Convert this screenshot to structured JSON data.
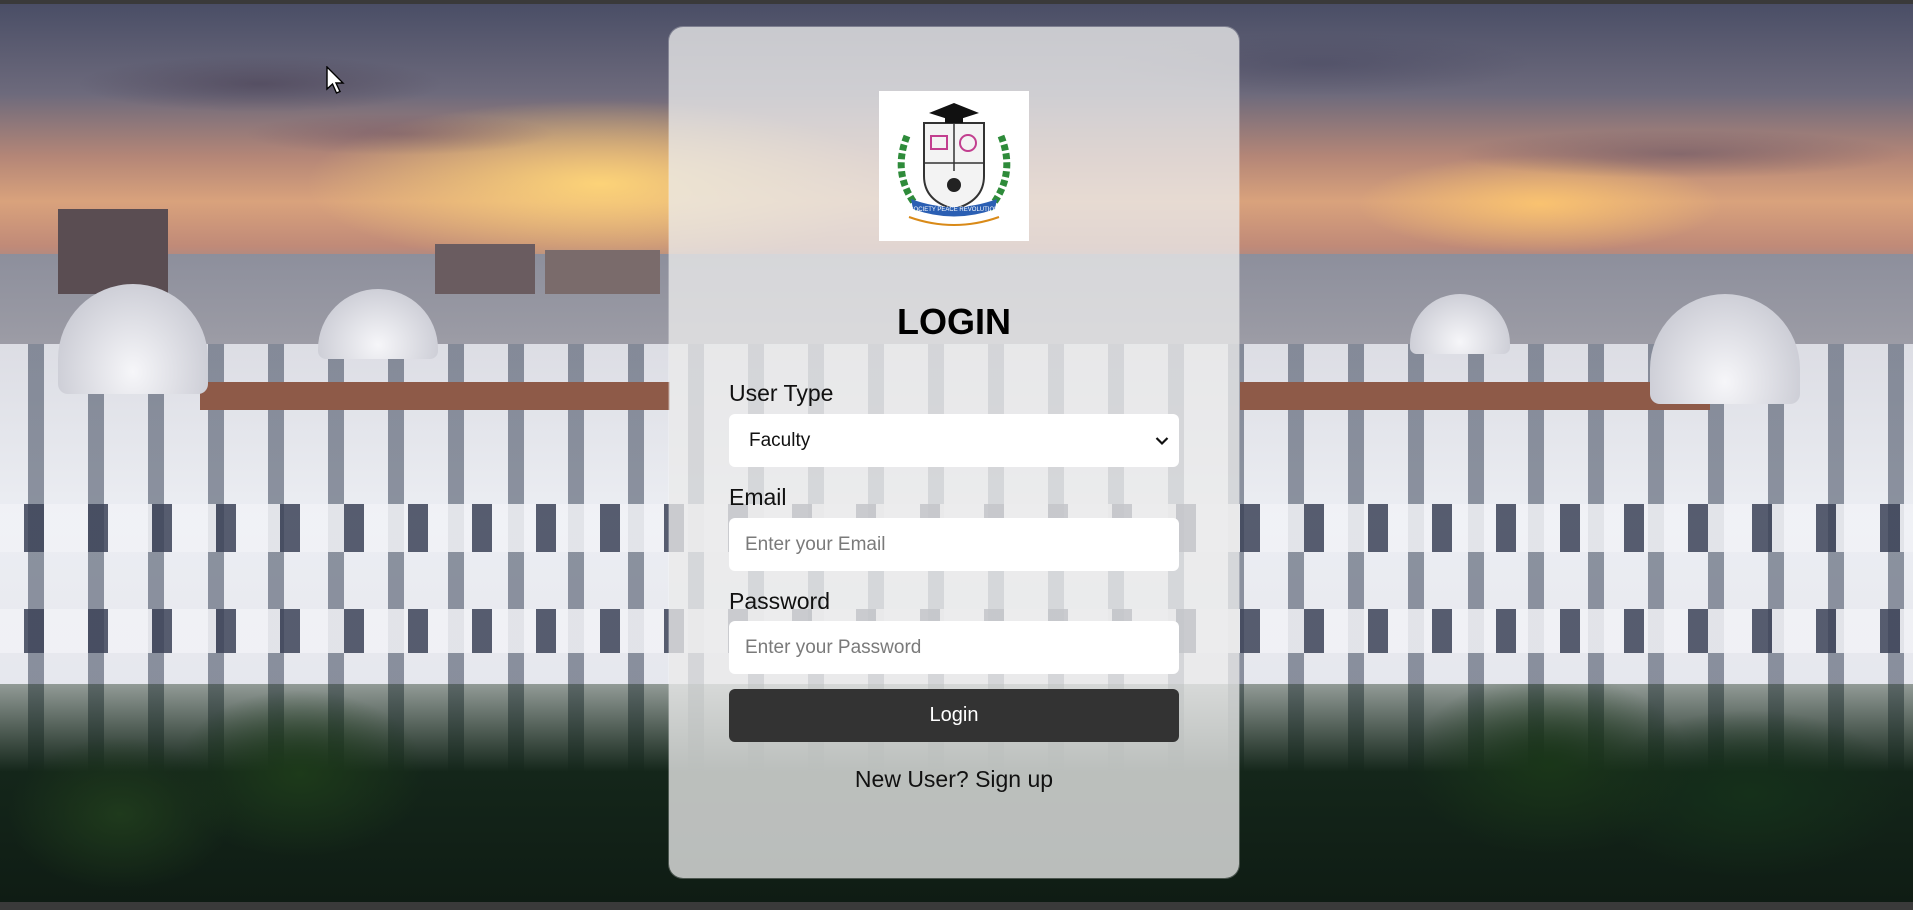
{
  "login": {
    "title": "LOGIN",
    "user_type_label": "User Type",
    "user_type_value": "Faculty",
    "email_label": "Email",
    "email_placeholder": "Enter your Email",
    "password_label": "Password",
    "password_placeholder": "Enter your Password",
    "login_button": "Login",
    "signup_link": "New User? Sign up"
  },
  "logo": {
    "icon": "institution-crest-icon",
    "motto_text": "SOCIETY PEACE REVOLUTION"
  },
  "colors": {
    "button_bg": "#333333",
    "card_bg": "rgba(235,235,235,0.78)",
    "laurel": "#2e8b3a",
    "ribbon": "#2b5fb3"
  }
}
